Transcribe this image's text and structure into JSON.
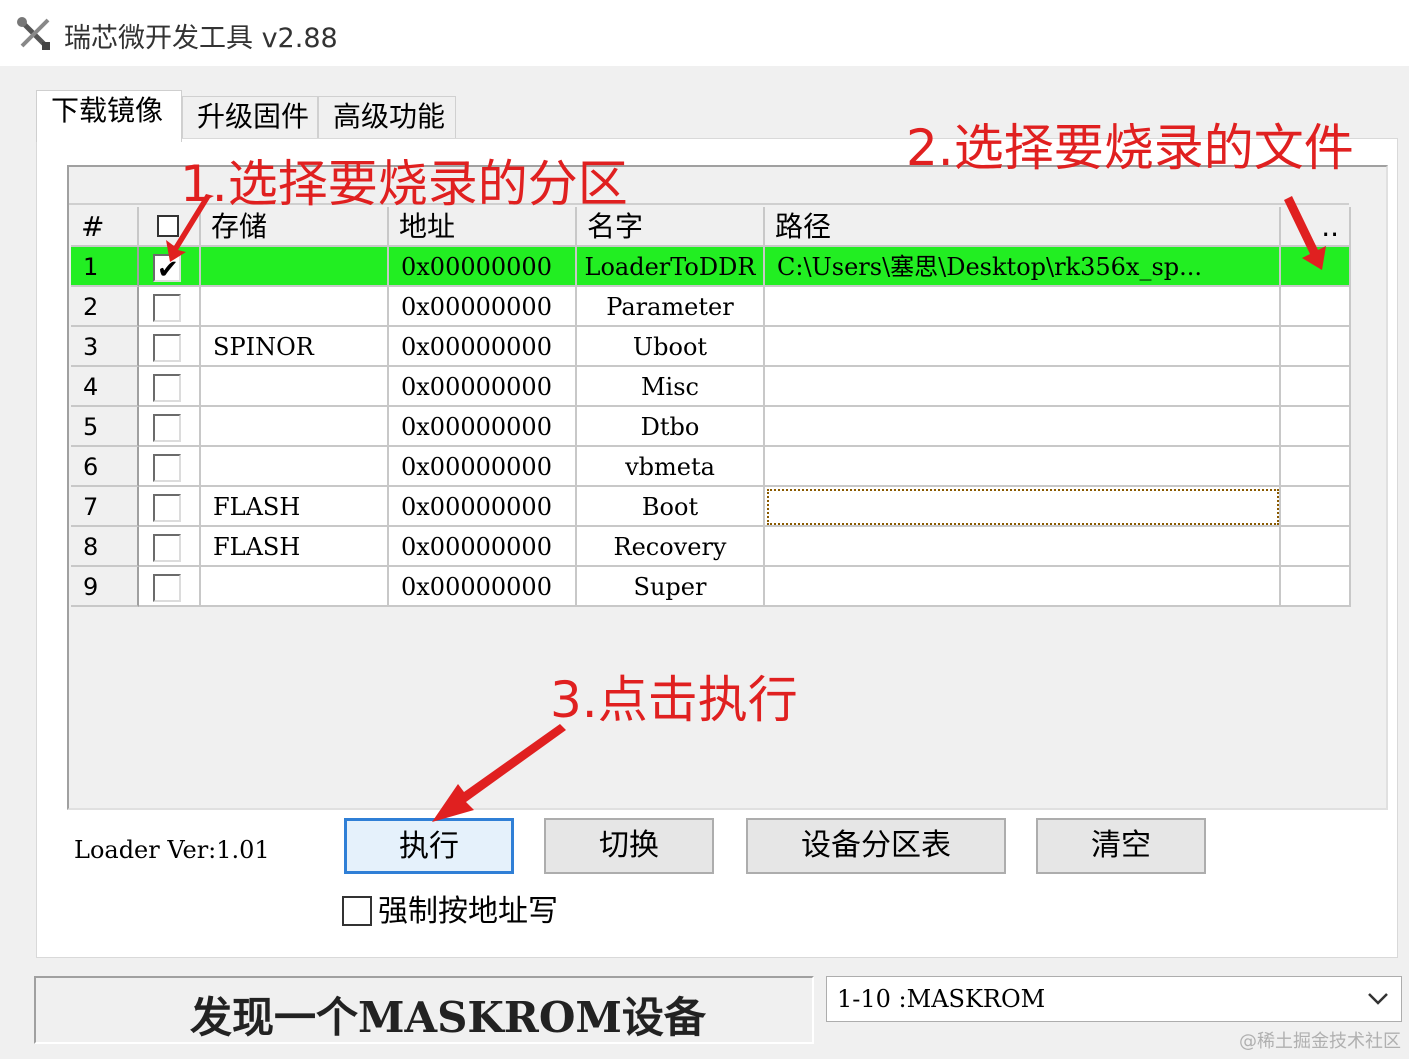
{
  "window": {
    "title": "瑞芯微开发工具 v2.88"
  },
  "tabs": [
    {
      "label": "下载镜像",
      "active": true
    },
    {
      "label": "升级固件",
      "active": false
    },
    {
      "label": "高级功能",
      "active": false
    }
  ],
  "grid": {
    "columns": [
      "#",
      "",
      "存储",
      "地址",
      "名字",
      "路径",
      ".."
    ],
    "rows": [
      {
        "num": "1",
        "checked": true,
        "storage": "",
        "address": "0x00000000",
        "name": "LoaderToDDR",
        "path": "C:\\Users\\塞思\\Desktop\\rk356x_sp...",
        "selected": true
      },
      {
        "num": "2",
        "checked": false,
        "storage": "",
        "address": "0x00000000",
        "name": "Parameter",
        "path": ""
      },
      {
        "num": "3",
        "checked": false,
        "storage": "SPINOR",
        "address": "0x00000000",
        "name": "Uboot",
        "path": ""
      },
      {
        "num": "4",
        "checked": false,
        "storage": "",
        "address": "0x00000000",
        "name": "Misc",
        "path": ""
      },
      {
        "num": "5",
        "checked": false,
        "storage": "",
        "address": "0x00000000",
        "name": "Dtbo",
        "path": ""
      },
      {
        "num": "6",
        "checked": false,
        "storage": "",
        "address": "0x00000000",
        "name": "vbmeta",
        "path": ""
      },
      {
        "num": "7",
        "checked": false,
        "storage": "FLASH",
        "address": "0x00000000",
        "name": "Boot",
        "path": "",
        "focused": true
      },
      {
        "num": "8",
        "checked": false,
        "storage": "FLASH",
        "address": "0x00000000",
        "name": "Recovery",
        "path": ""
      },
      {
        "num": "9",
        "checked": false,
        "storage": "",
        "address": "0x00000000",
        "name": "Super",
        "path": ""
      }
    ]
  },
  "bottom": {
    "loader_version": "Loader Ver:1.01",
    "buttons": {
      "execute": "执行",
      "switch": "切换",
      "partition_table": "设备分区表",
      "clear": "清空"
    },
    "force_write_label": "强制按地址写"
  },
  "status": {
    "message": "发现一个MASKROM设备",
    "device": "1-10 :MASKROM"
  },
  "annotations": {
    "step1": "1.选择要烧录的分区",
    "step2": "2.选择要烧录的文件",
    "step3": "3.点击执行",
    "color": "#e02020"
  },
  "watermark": "@稀土掘金技术社区",
  "colors": {
    "selected_row": "#22ee22",
    "primary_border": "#2f7fd6"
  }
}
